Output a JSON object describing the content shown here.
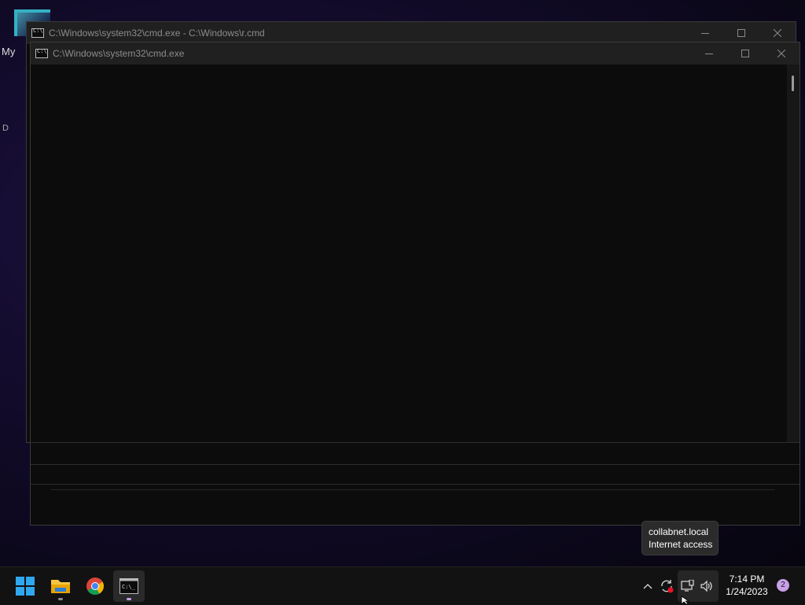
{
  "desktop": {
    "icon_label": "My",
    "icon_label2": "D"
  },
  "windows": {
    "back": {
      "title": "C:\\Windows\\system32\\cmd.exe - C:\\Windows\\r.cmd"
    },
    "front": {
      "title": "C:\\Windows\\system32\\cmd.exe"
    }
  },
  "taskbar": {
    "apps": [
      {
        "name": "start-button",
        "icon": "windows-logo-icon"
      },
      {
        "name": "file-explorer",
        "icon": "folder-icon"
      },
      {
        "name": "chrome",
        "icon": "chrome-icon"
      },
      {
        "name": "command-prompt",
        "icon": "cmd-icon"
      }
    ],
    "tray": {
      "overflow_icon": "chevron-up-icon",
      "sync_icon": "sync-icon",
      "network_icon": "network-icon",
      "volume_icon": "volume-icon"
    },
    "clock": {
      "time": "7:14 PM",
      "date": "1/24/2023"
    },
    "notifications": "2"
  },
  "tooltip": {
    "line1": "collabnet.local",
    "line2": "Internet access"
  },
  "colors": {
    "accent": "#c8a0e8",
    "windows_blue": "#2fa8f0",
    "sync_badge": "#e81123"
  }
}
